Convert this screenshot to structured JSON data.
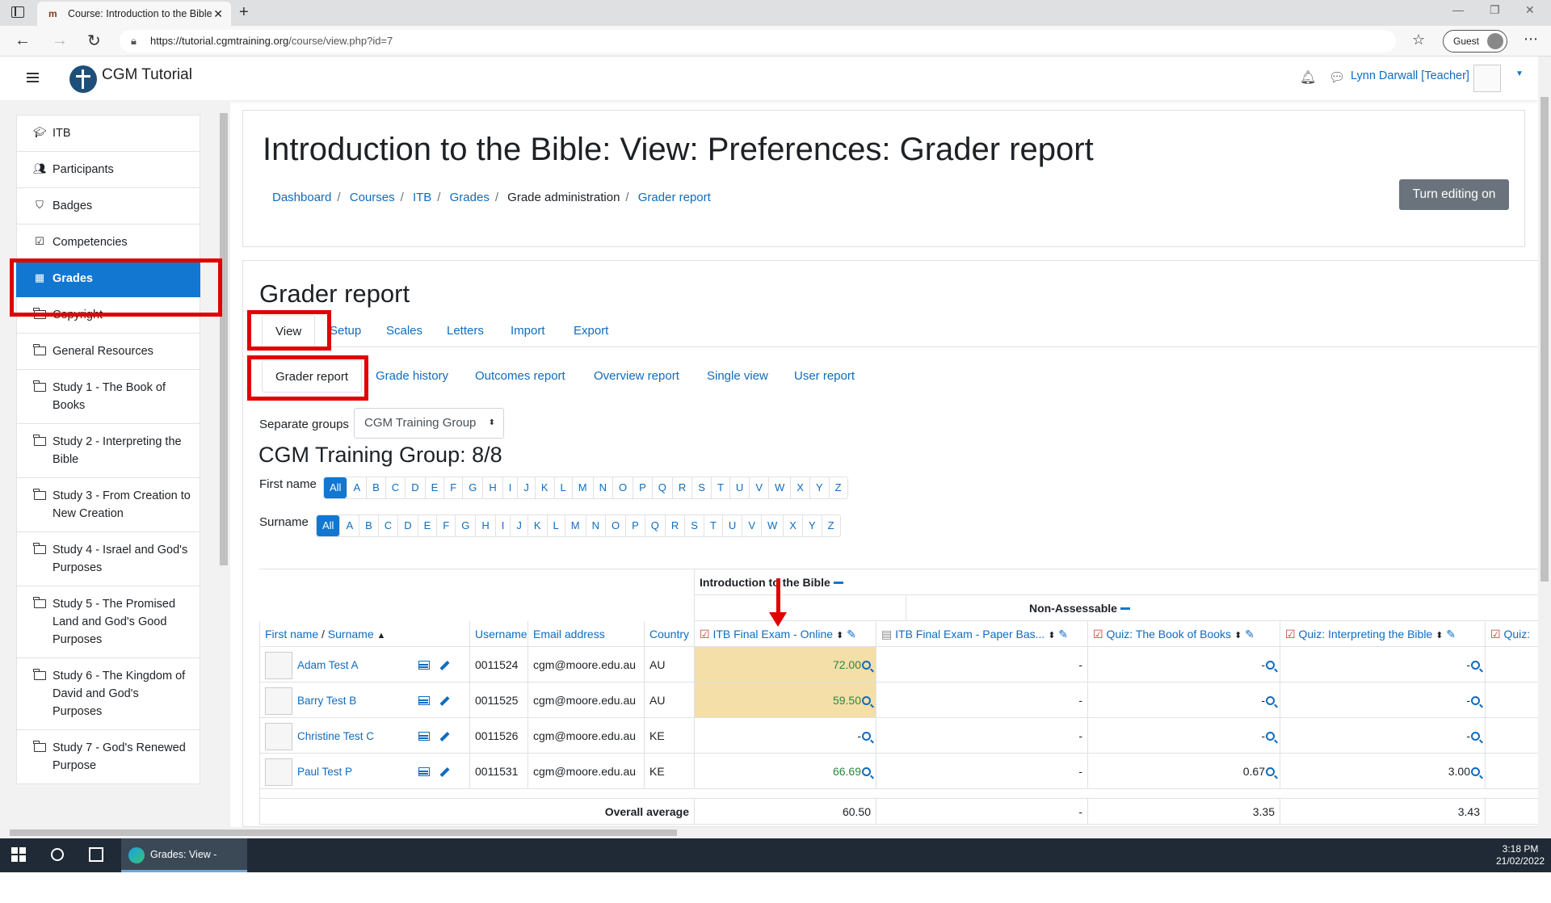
{
  "browser": {
    "tab_title": "Course: Introduction to the Bible",
    "url_host": "https://tutorial.cgmtraining.org",
    "url_path": "/course/view.php?id=7",
    "profile": "Guest"
  },
  "navbar": {
    "site_name": "CGM Tutorial",
    "user": "Lynn Darwall [Teacher]"
  },
  "sidebar": {
    "items": [
      {
        "label": "ITB",
        "icon": "graduation-cap-icon"
      },
      {
        "label": "Participants",
        "icon": "users-icon"
      },
      {
        "label": "Badges",
        "icon": "shield-icon"
      },
      {
        "label": "Competencies",
        "icon": "checkbox-icon"
      },
      {
        "label": "Grades",
        "icon": "table-icon",
        "active": true
      },
      {
        "label": "Copyright",
        "icon": "folder-icon"
      },
      {
        "label": "General Resources",
        "icon": "folder-icon"
      },
      {
        "label": "Study 1 - The Book of Books",
        "icon": "folder-icon"
      },
      {
        "label": "Study 2 - Interpreting the Bible",
        "icon": "folder-icon"
      },
      {
        "label": "Study 3 - From Creation to New Creation",
        "icon": "folder-icon"
      },
      {
        "label": "Study 4 - Israel and God's Purposes",
        "icon": "folder-icon"
      },
      {
        "label": "Study 5 - The Promised Land and God's Good Purposes",
        "icon": "folder-icon"
      },
      {
        "label": "Study 6 - The Kingdom of David and God's Purposes",
        "icon": "folder-icon"
      },
      {
        "label": "Study 7 - God's Renewed Purpose",
        "icon": "folder-icon"
      }
    ]
  },
  "page": {
    "title": "Introduction to the Bible: View: Preferences: Grader report",
    "breadcrumb": [
      "Dashboard",
      "Courses",
      "ITB",
      "Grades",
      "Grade administration",
      "Grader report"
    ],
    "edit_button": "Turn editing on",
    "section_title": "Grader report",
    "tabs1": [
      "View",
      "Setup",
      "Scales",
      "Letters",
      "Import",
      "Export"
    ],
    "tabs2": [
      "Grader report",
      "Grade history",
      "Outcomes report",
      "Overview report",
      "Single view",
      "User report"
    ],
    "group_label": "Separate groups",
    "group_value": "CGM Training Group",
    "group_heading": "CGM Training Group: 8/8",
    "firstname_label": "First name",
    "surname_label": "Surname",
    "initials": [
      "All",
      "A",
      "B",
      "C",
      "D",
      "E",
      "F",
      "G",
      "H",
      "I",
      "J",
      "K",
      "L",
      "M",
      "N",
      "O",
      "P",
      "Q",
      "R",
      "S",
      "T",
      "U",
      "V",
      "W",
      "X",
      "Y",
      "Z"
    ]
  },
  "table": {
    "category_main": "Introduction to the Bible",
    "category_sub": "Non-Assessable",
    "headers": {
      "name_first": "First name",
      "name_sep": " / ",
      "name_last": "Surname",
      "username": "Username",
      "email": "Email address",
      "country": "Country",
      "g1": "ITB Final Exam - Online",
      "g2": "ITB Final Exam - Paper Bas...",
      "g3": "Quiz: The Book of Books",
      "g4": "Quiz: Interpreting the Bible",
      "g5": "Quiz:"
    },
    "rows": [
      {
        "name": "Adam Test A",
        "username": "0011524",
        "email": "cgm@moore.edu.au",
        "country": "AU",
        "g1": "72.00",
        "g2": "-",
        "g3": "-",
        "g4": "-"
      },
      {
        "name": "Barry Test B",
        "username": "0011525",
        "email": "cgm@moore.edu.au",
        "country": "AU",
        "g1": "59.50",
        "g2": "-",
        "g3": "-",
        "g4": "-"
      },
      {
        "name": "Christine Test C",
        "username": "0011526",
        "email": "cgm@moore.edu.au",
        "country": "KE",
        "g1": "-",
        "g2": "-",
        "g3": "-",
        "g4": "-"
      },
      {
        "name": "Paul Test P",
        "username": "0011531",
        "email": "cgm@moore.edu.au",
        "country": "KE",
        "g1": "66.69",
        "g2": "-",
        "g3": "0.67",
        "g4": "3.00"
      }
    ],
    "overall_label": "Overall average",
    "overall": {
      "g1": "60.50",
      "g2": "-",
      "g3": "3.35",
      "g4": "3.43"
    }
  },
  "taskbar": {
    "app_label": "Grades: View - [Gue...",
    "time": "3:18 PM",
    "date": "21/02/2022"
  }
}
